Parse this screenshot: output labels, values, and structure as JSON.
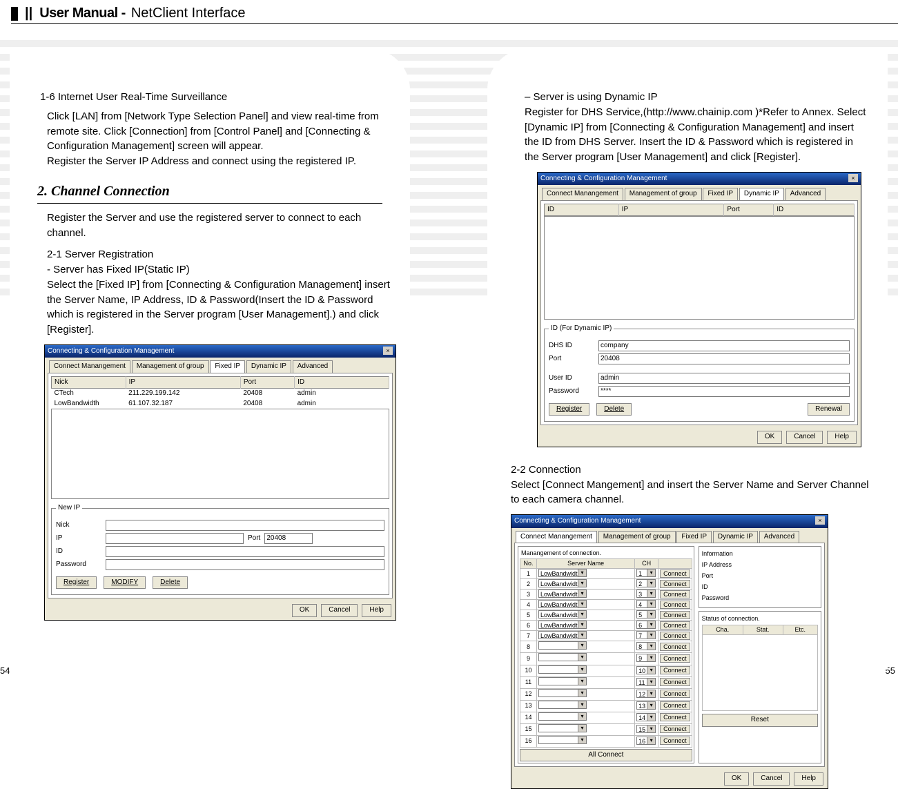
{
  "header": {
    "title_main": "User Manual -",
    "title_sub": "NetClient Interface",
    "bars": "||"
  },
  "page_left": "54",
  "page_right": "55",
  "left": {
    "s16_head": "1-6 Internet User Real-Time Surveillance",
    "s16_body": "Click [LAN] from [Network Type Selection Panel] and view real-time from remote site. Click [Connection] from [Control Panel] and [Connecting & Configuration Management] screen will appear.\nRegister the Server IP Address and connect using the registered IP.",
    "h2": "2. Channel Connection",
    "h2_body": "Register the Server and use the registered server to connect to each channel.",
    "s21_head": "2-1 Server Registration",
    "s21_sub": "- Server has Fixed IP(Static IP)",
    "s21_body": "Select the [Fixed IP] from [Connecting & Configuration Management] insert the Server Name, IP Address, ID & Password(Insert the ID & Password which is registered in the Server program [User Management].) and click [Register].",
    "shot": {
      "title": "Connecting & Configuration Management",
      "tabs": [
        "Connect Manangement",
        "Management of group",
        "Fixed IP",
        "Dynamic IP",
        "Advanced"
      ],
      "active_tab": 2,
      "cols": [
        "Nick",
        "IP",
        "Port",
        "ID"
      ],
      "rows": [
        {
          "nick": "CTech",
          "ip": "211.229.199.142",
          "port": "20408",
          "id": "admin"
        },
        {
          "nick": "LowBandwidth",
          "ip": "61.107.32.187",
          "port": "20408",
          "id": "admin"
        }
      ],
      "newip_legend": "New IP",
      "lbl_nick": "Nick",
      "lbl_ip": "IP",
      "lbl_port": "Port",
      "val_port": "20408",
      "lbl_id": "ID",
      "lbl_pw": "Password",
      "btn_register": "Register",
      "btn_modify": "MODIFY",
      "btn_delete": "Delete",
      "btn_ok": "OK",
      "btn_cancel": "Cancel",
      "btn_help": "Help"
    }
  },
  "right": {
    "dyn_head": "–  Server is using Dynamic IP",
    "dyn_body": "Register for DHS Service,(http://www.chainip.com )*Refer to Annex. Select [Dynamic IP] from [Connecting & Configuration Management] and insert the ID from DHS Server. Insert the ID & Password which is registered in the Server program [User Management] and click [Register].",
    "shot1": {
      "title": "Connecting & Configuration Management",
      "tabs": [
        "Connect Manangement",
        "Management of group",
        "Fixed IP",
        "Dynamic IP",
        "Advanced"
      ],
      "active_tab": 3,
      "cols": [
        "ID",
        "IP",
        "Port",
        "ID"
      ],
      "legend": "ID (For Dynamic IP)",
      "lbl_dhs": "DHS ID",
      "val_dhs": "company",
      "lbl_port": "Port",
      "val_port": "20408",
      "lbl_uid": "User ID",
      "val_uid": "admin",
      "lbl_pw": "Password",
      "val_pw": "****",
      "btn_register": "Register",
      "btn_delete": "Delete",
      "btn_renewal": "Renewal",
      "btn_ok": "OK",
      "btn_cancel": "Cancel",
      "btn_help": "Help"
    },
    "s22_head": "2-2 Connection",
    "s22_body": "Select [Connect Mangement] and insert the Server Name and Server Channel to each camera channel.",
    "shot2": {
      "title": "Connecting & Configuration Management",
      "tabs": [
        "Connect Manangement",
        "Management of group",
        "Fixed IP",
        "Dynamic IP",
        "Advanced"
      ],
      "active_tab": 0,
      "mgmt_legend": "Manangement of connection.",
      "hdr_no": "No.",
      "hdr_server": "Server Name",
      "hdr_ch": "CH",
      "server_val": "LowBandwidth",
      "connect": "Connect",
      "allconnect": "All Connect",
      "info_legend": "Information",
      "info_ip": "IP Address",
      "info_port": "Port",
      "info_id": "ID",
      "info_pw": "Password",
      "status_legend": "Status of connection.",
      "status_cols": [
        "Cha.",
        "Stat.",
        "Etc."
      ],
      "btn_reset": "Reset",
      "btn_ok": "OK",
      "btn_cancel": "Cancel",
      "btn_help": "Help"
    }
  }
}
